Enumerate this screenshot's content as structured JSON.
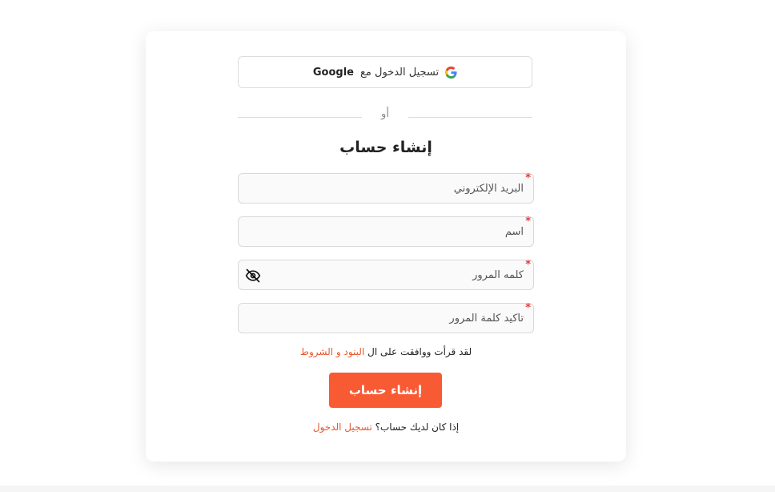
{
  "google": {
    "label": "تسجيل الدخول مع",
    "brand": "Google"
  },
  "divider": {
    "text": "أو"
  },
  "form": {
    "title": "إنشاء حساب",
    "required_mark": "*",
    "email_placeholder": "البريد الإلكتروني",
    "name_placeholder": "اسم",
    "password_placeholder": "كلمه المرور",
    "confirm_password_placeholder": "تأكيد كلمة المرور",
    "terms_text": "لقد قرأت ووافقت على ال",
    "terms_link": "البنود و الشروط",
    "submit_label": "إنشاء حساب",
    "login_prompt": "إذا كان لديك حساب؟",
    "login_link": "تسجيل الدخول"
  },
  "icons": {
    "google": "google-g-icon",
    "password_toggle": "eye-slash-icon"
  },
  "colors": {
    "accent": "#f85a34",
    "link": "#e6582f",
    "required": "#e53935"
  }
}
